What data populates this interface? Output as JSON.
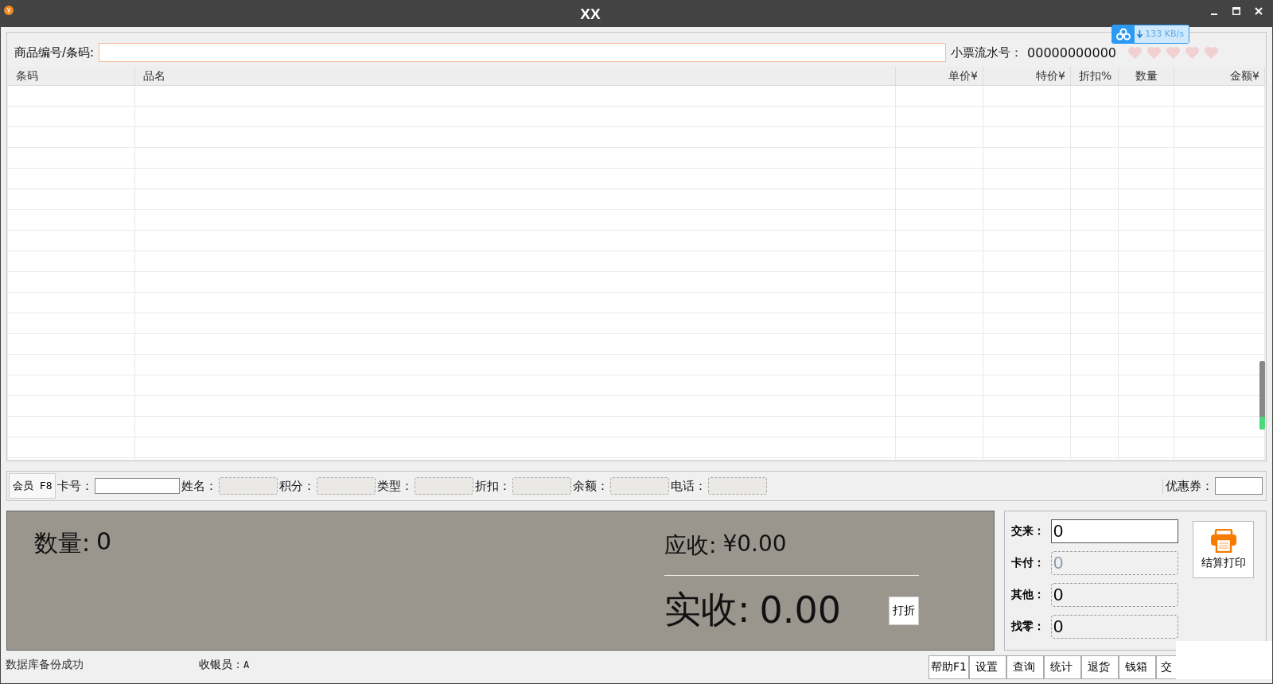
{
  "window": {
    "title": "XX"
  },
  "download_widget": {
    "speed": "133 KB/s"
  },
  "search": {
    "label": "商品编号/条码:"
  },
  "ticket": {
    "label": "小票流水号：",
    "value": "00000000000"
  },
  "table": {
    "columns": [
      "条码",
      "品名",
      "单价¥",
      "特价¥",
      "折扣%",
      "数量",
      "金额¥"
    ]
  },
  "member": {
    "button": "会员 F8",
    "fields": [
      {
        "label": "卡号：",
        "kind": "input"
      },
      {
        "label": "姓名：",
        "kind": "readonly"
      },
      {
        "label": "积分：",
        "kind": "readonly"
      },
      {
        "label": "类型：",
        "kind": "readonly"
      },
      {
        "label": "折扣：",
        "kind": "readonly"
      },
      {
        "label": "余额：",
        "kind": "readonly"
      },
      {
        "label": "电话：",
        "kind": "readonly"
      }
    ],
    "coupon_label": "优惠券："
  },
  "summary": {
    "quantity_label": "数量:",
    "quantity": "0",
    "due_label": "应收:",
    "due": "¥0.00",
    "received_label": "实收:",
    "received": "0.00",
    "discount_button": "打折"
  },
  "payment": {
    "rows": [
      {
        "label": "交来：",
        "value": "0",
        "kind": "input"
      },
      {
        "label": "卡付：",
        "value": "0",
        "kind": "disabled"
      },
      {
        "label": "其他：",
        "value": "0",
        "kind": "readonly"
      },
      {
        "label": "找零：",
        "value": "0",
        "kind": "readonly"
      }
    ],
    "checkout_button": "结算打印"
  },
  "status_bar": {
    "message": "数据库备份成功",
    "cashier_label": "收银员：",
    "cashier": "A",
    "buttons": [
      "帮助F1",
      "设置",
      "查询",
      "统计",
      "退货",
      "钱箱",
      "交"
    ]
  }
}
